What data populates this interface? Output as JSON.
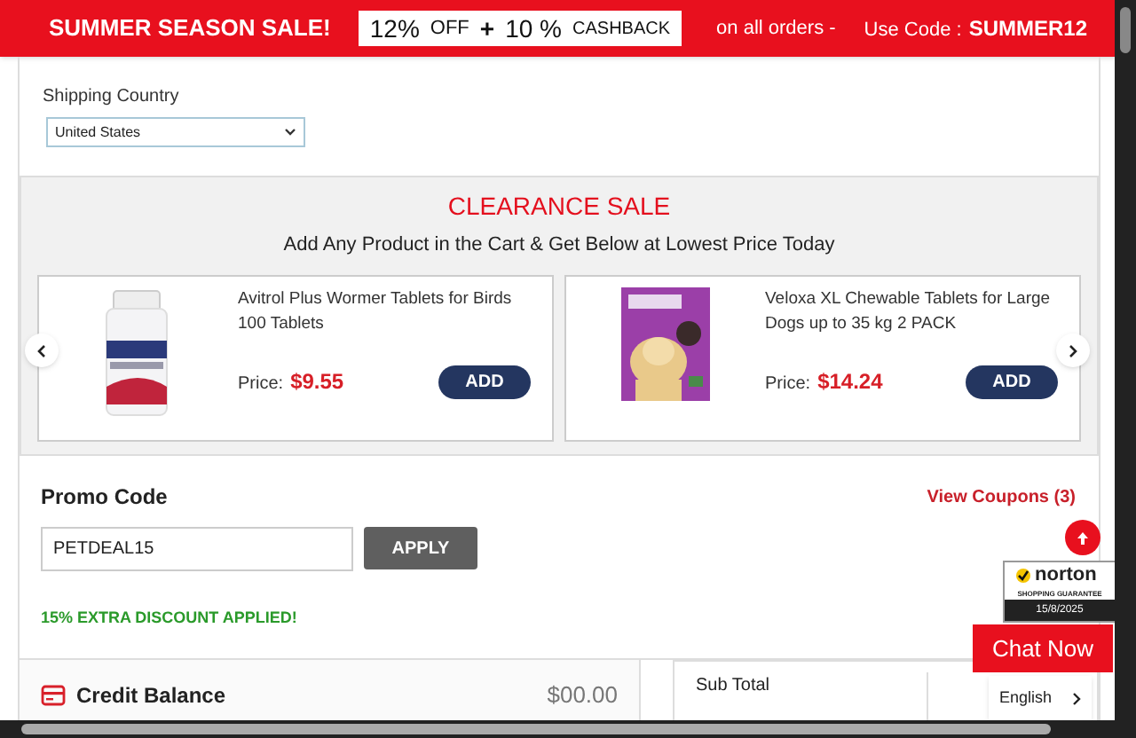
{
  "banner": {
    "title": "SUMMER SEASON SALE!",
    "offer": [
      "12%",
      "OFF",
      "+",
      "10 %",
      "CASHBACK"
    ],
    "note": "on all orders -",
    "code_label": "Use Code :",
    "code": "SUMMER12"
  },
  "shipping": {
    "label": "Shipping Country",
    "value": "United States"
  },
  "clearance": {
    "title": "CLEARANCE SALE",
    "subtitle": "Add Any Product in the Cart & Get Below at Lowest Price Today",
    "products": [
      {
        "name": "Avitrol Plus Wormer Tablets for Birds 100 Tablets",
        "price_label": "Price:",
        "price": "$9.55",
        "button": "ADD"
      },
      {
        "name": "Veloxa XL Chewable Tablets for Large Dogs up to 35 kg 2 PACK",
        "price_label": "Price:",
        "price": "$14.24",
        "button": "ADD"
      }
    ]
  },
  "promo": {
    "title": "Promo Code",
    "link": "View Coupons (3)",
    "value": "PETDEAL15",
    "button": "APPLY",
    "message": "15% EXTRA DISCOUNT APPLIED!"
  },
  "credit": {
    "label": "Credit Balance",
    "amount": "$00.00"
  },
  "totals": {
    "rows": [
      "Sub Total"
    ]
  },
  "norton": {
    "brand": "norton",
    "tagline": "SHOPPING GUARANTEE",
    "date": "15/8/2025"
  },
  "chat": "Chat Now",
  "language": "English"
}
